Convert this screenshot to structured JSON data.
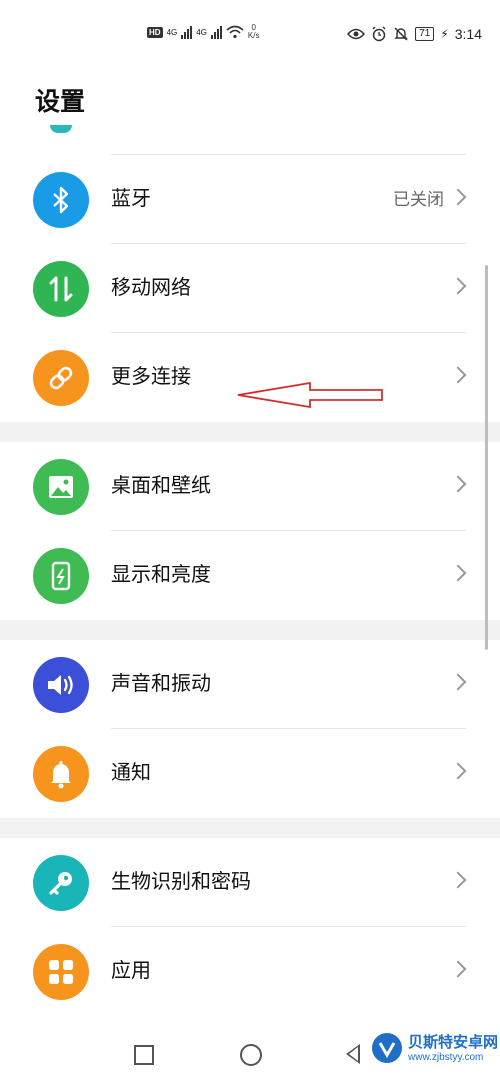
{
  "status_bar": {
    "hd": "HD",
    "signal1": "4G",
    "signal2": "4G",
    "net_speed_value": "0",
    "net_speed_unit": "K/s",
    "battery": "71",
    "time": "3:14"
  },
  "title": "设置",
  "groups": [
    {
      "items": [
        {
          "name": "bluetooth",
          "label": "蓝牙",
          "value": "已关闭",
          "color": "#1a9be6",
          "icon": "bluetooth-icon"
        },
        {
          "name": "mobile-network",
          "label": "移动网络",
          "value": "",
          "color": "#2fb552",
          "icon": "updown-arrows-icon"
        },
        {
          "name": "more-connections",
          "label": "更多连接",
          "value": "",
          "color": "#f7941d",
          "icon": "link-icon"
        }
      ]
    },
    {
      "items": [
        {
          "name": "wallpaper",
          "label": "桌面和壁纸",
          "value": "",
          "color": "#3ebb52",
          "icon": "image-icon"
        },
        {
          "name": "display",
          "label": "显示和亮度",
          "value": "",
          "color": "#3ebb52",
          "icon": "phone-brightness-icon"
        }
      ]
    },
    {
      "items": [
        {
          "name": "sound",
          "label": "声音和振动",
          "value": "",
          "color": "#3b4fd8",
          "icon": "speaker-icon"
        },
        {
          "name": "notifications",
          "label": "通知",
          "value": "",
          "color": "#f7941d",
          "icon": "bell-icon"
        }
      ]
    },
    {
      "items": [
        {
          "name": "biometrics",
          "label": "生物识别和密码",
          "value": "",
          "color": "#1ab5b8",
          "icon": "key-icon"
        },
        {
          "name": "apps",
          "label": "应用",
          "value": "",
          "color": "#f7941d",
          "icon": "apps-grid-icon"
        }
      ]
    }
  ],
  "watermark": {
    "text": "贝斯特安卓网",
    "url": "www.zjbstyy.com"
  },
  "colors": {
    "arrow": "#d03030",
    "accent": "#1a9be6"
  }
}
